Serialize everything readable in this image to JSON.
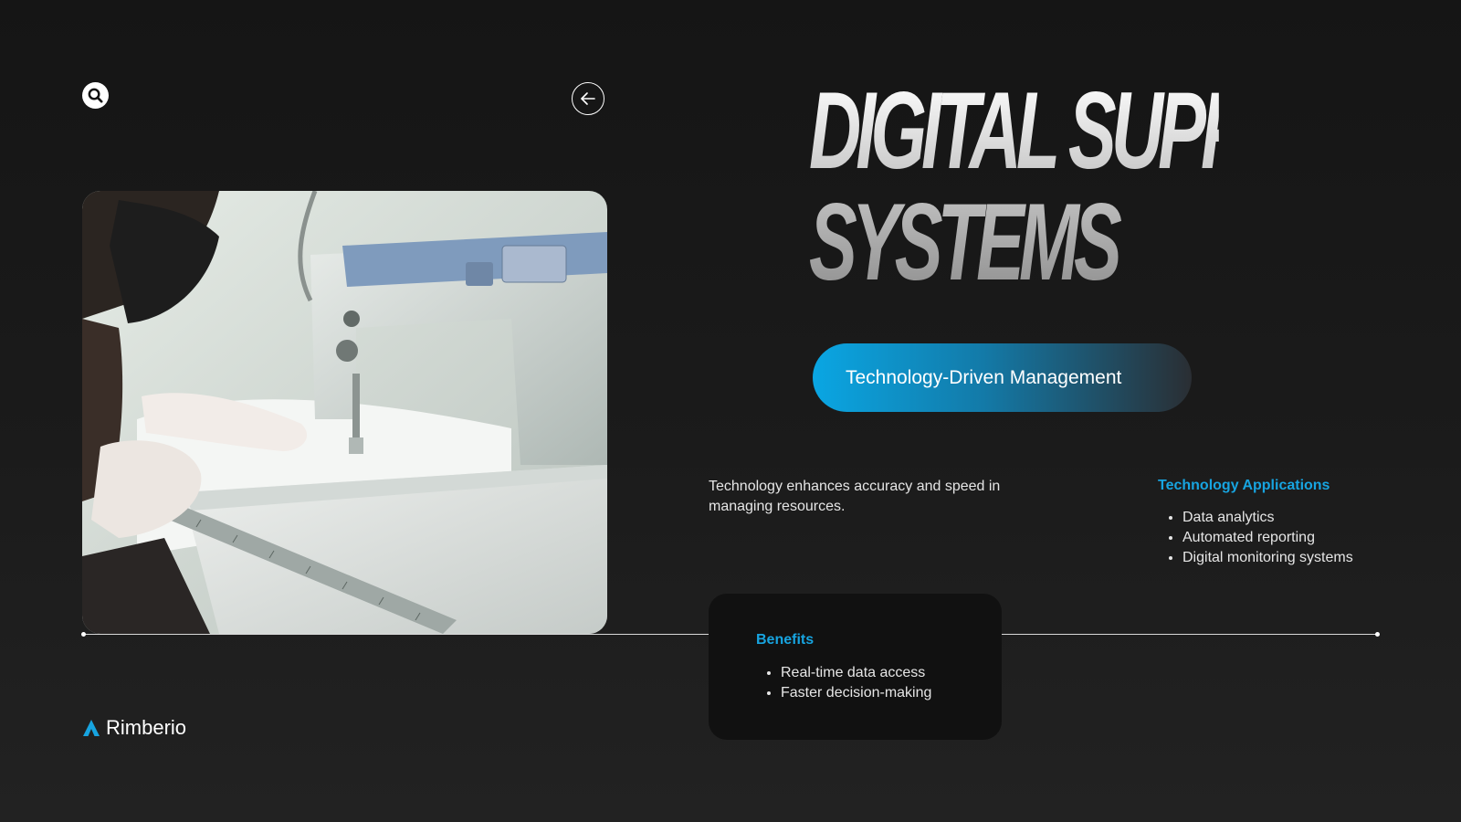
{
  "header": {
    "search_icon": "search-icon",
    "back_icon": "arrow-left-icon"
  },
  "hero": {
    "title_line1": "DIGITAL SUPPORT",
    "title_line2": "SYSTEMS",
    "pill_label": "Technology-Driven Management"
  },
  "photo": {
    "subject": "sewing-machine-photo"
  },
  "description": "Technology enhances accuracy and speed in managing resources.",
  "applications": {
    "title": "Technology Applications",
    "items": [
      "Data analytics",
      "Automated reporting",
      "Digital monitoring systems"
    ]
  },
  "benefits": {
    "title": "Benefits",
    "items": [
      "Real-time data access",
      "Faster decision-making"
    ]
  },
  "brand": {
    "name": "Rimberio"
  },
  "colors": {
    "accent": "#17a4e0",
    "background": "#1a1a1a",
    "card": "#111111"
  }
}
